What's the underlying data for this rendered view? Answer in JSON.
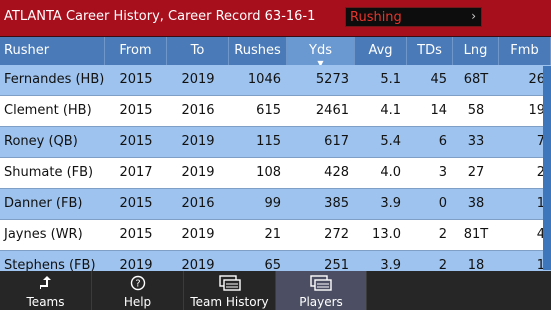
{
  "titlebar": {
    "title": "ATLANTA Career History, Career Record 63-16-1",
    "dropdown_value": "Rushing",
    "dropdown_arrow": "›"
  },
  "table": {
    "columns": [
      "Rusher",
      "From",
      "To",
      "Rushes",
      "Yds",
      "Avg",
      "TDs",
      "Lng",
      "Fmb"
    ],
    "sorted_column": "Yds",
    "rows": [
      [
        "Fernandes (HB)",
        "2015",
        "2019",
        "1046",
        "5273",
        "5.1",
        "45",
        "68T",
        "26"
      ],
      [
        "Clement (HB)",
        "2015",
        "2016",
        "615",
        "2461",
        "4.1",
        "14",
        "58",
        "19"
      ],
      [
        "Roney (QB)",
        "2015",
        "2019",
        "115",
        "617",
        "5.4",
        "6",
        "33",
        "7"
      ],
      [
        "Shumate (FB)",
        "2017",
        "2019",
        "108",
        "428",
        "4.0",
        "3",
        "27",
        "2"
      ],
      [
        "Danner (FB)",
        "2015",
        "2016",
        "99",
        "385",
        "3.9",
        "0",
        "38",
        "1"
      ],
      [
        "Jaynes (WR)",
        "2015",
        "2019",
        "21",
        "272",
        "13.0",
        "2",
        "81T",
        "4"
      ],
      [
        "Stephens (FB)",
        "2019",
        "2019",
        "65",
        "251",
        "3.9",
        "2",
        "18",
        "1"
      ]
    ]
  },
  "tabs": [
    {
      "label": "Teams",
      "icon": "back-arrow-icon"
    },
    {
      "label": "Help",
      "icon": "question-icon"
    },
    {
      "label": "Team History",
      "icon": "cards-icon"
    },
    {
      "label": "Players",
      "icon": "cards-icon"
    }
  ],
  "colors": {
    "titlebar": "#a80f1d",
    "header": "#4a7ab8",
    "row_alt": "#9dc3ee",
    "dropdown_text": "#e8342b",
    "active_tab": "#4c4f64"
  }
}
